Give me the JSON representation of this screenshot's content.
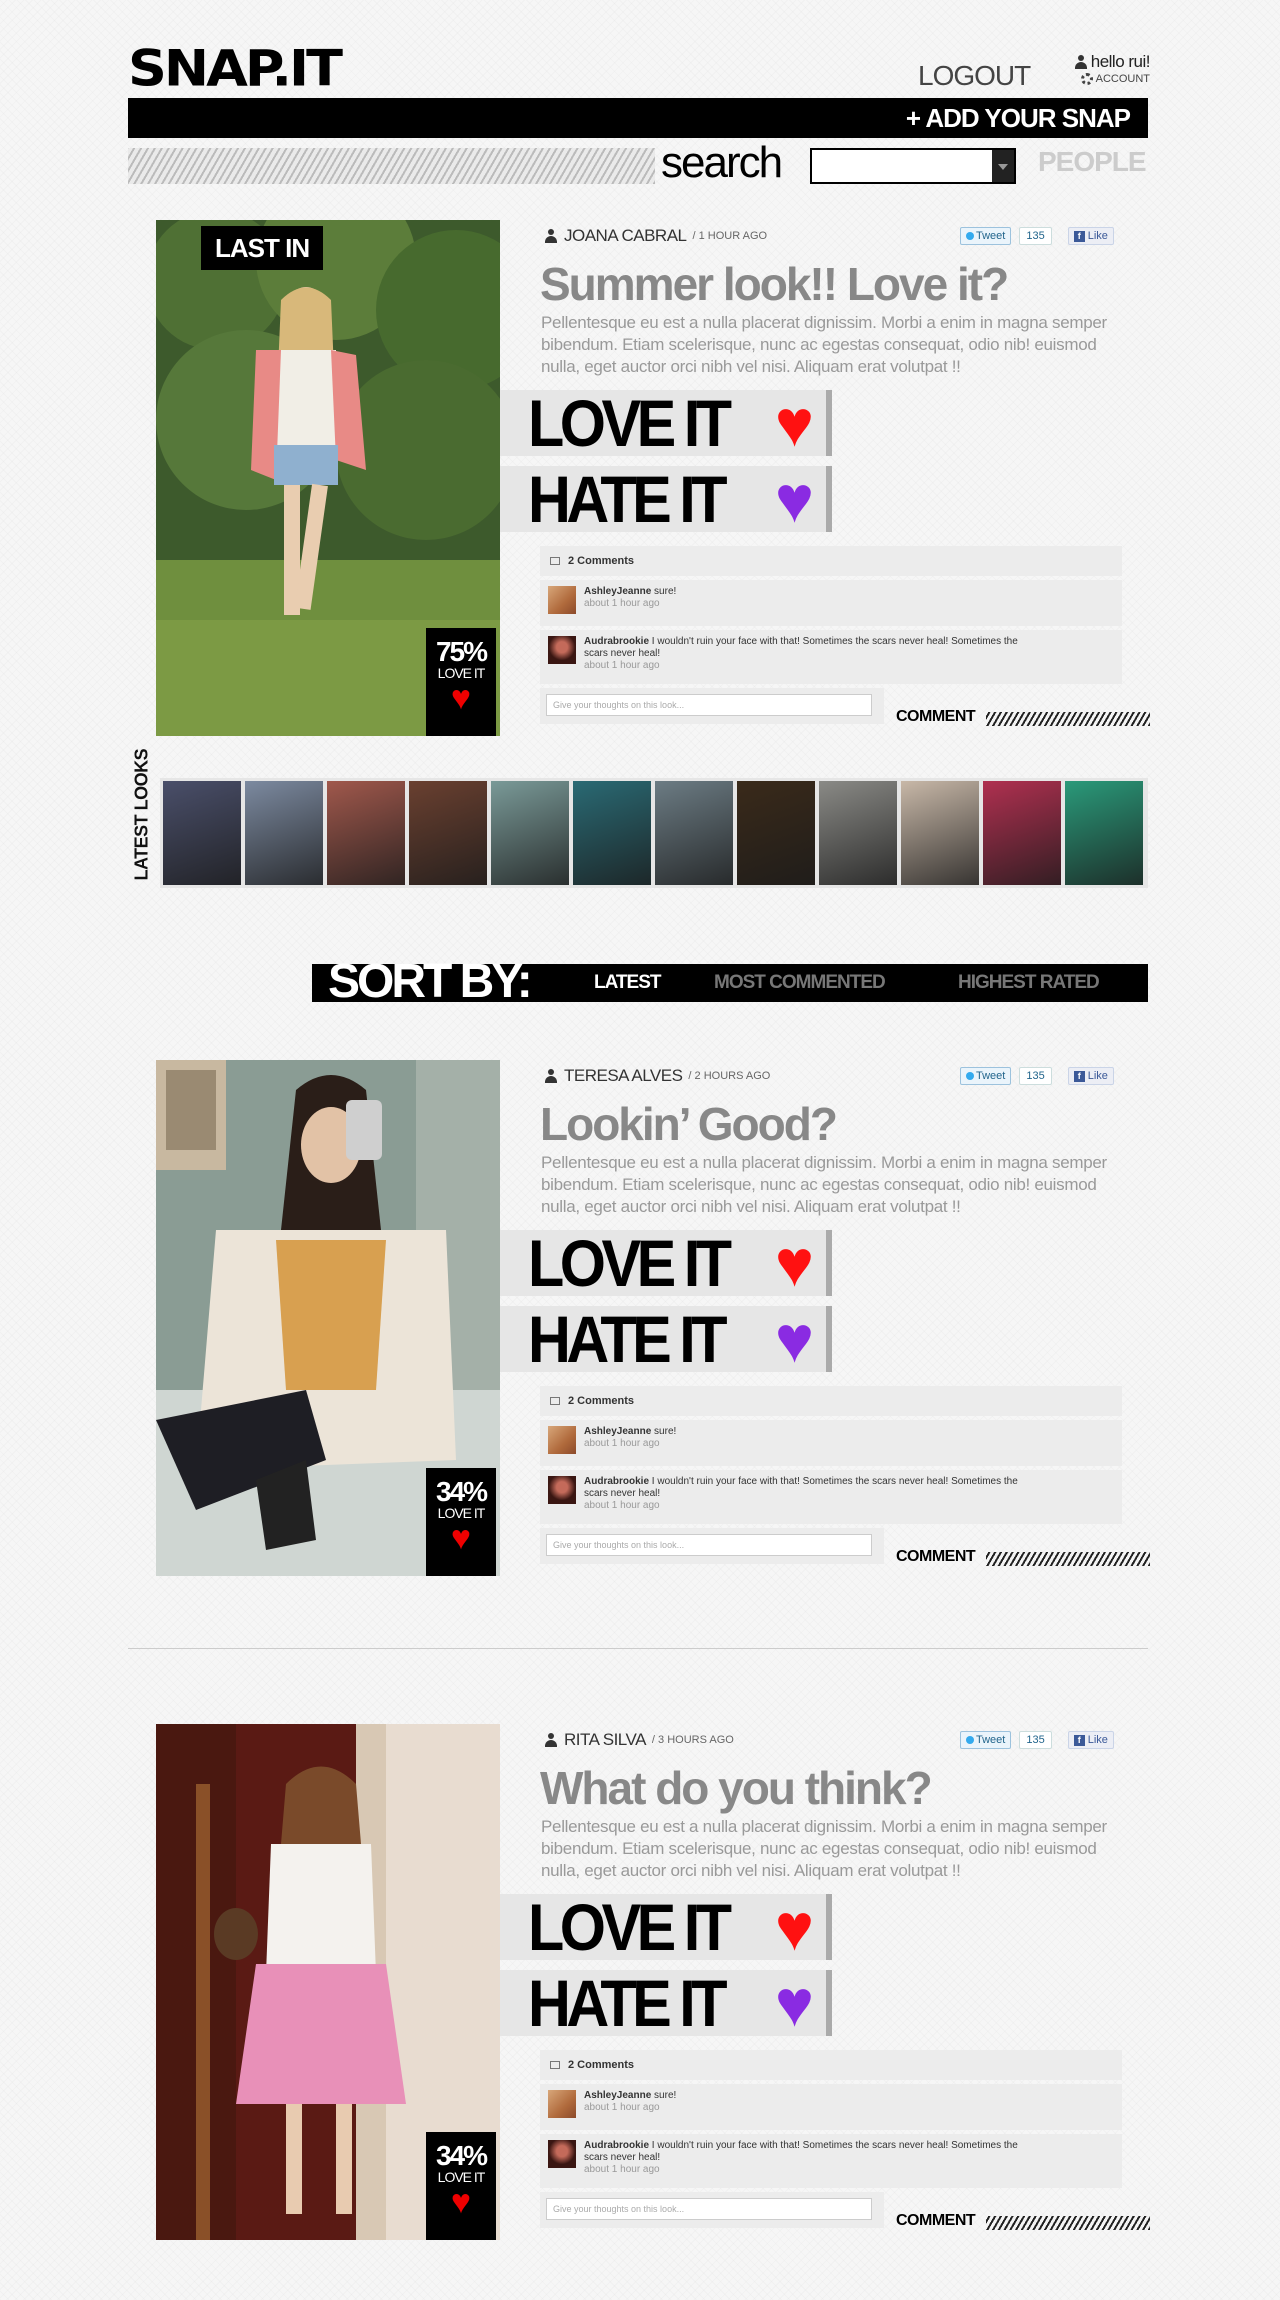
{
  "header": {
    "logo": "SNAP.IT",
    "logout": "LOGOUT",
    "greeting": "hello rui!",
    "account": "ACCOUNT",
    "add_snap": "+ ADD YOUR SNAP",
    "search_label": "search",
    "search_value": "",
    "people": "PEOPLE"
  },
  "posts": [
    {
      "badge": "LAST IN",
      "author": "JOANA CABRAL",
      "time": "/ 1 HOUR AGO",
      "tweet": "Tweet",
      "tweet_count": "135",
      "like": "Like",
      "title": "Summer look!! Love it?",
      "body": "Pellentesque eu est a nulla placerat dignissim. Morbi a enim in magna semper bibendum. Etiam scelerisque, nunc ac egestas consequat, odio nib! euismod nulla, eget auctor orci nibh vel nisi. Aliquam erat volutpat !!",
      "love_label": "LOVE IT",
      "hate_label": "HATE IT",
      "score": "75%",
      "score_label": "LOVE IT",
      "comments_header": "2 Comments",
      "comments": [
        {
          "user": "AshleyJeanne",
          "text": "sure!",
          "meta": "about 1 hour ago"
        },
        {
          "user": "Audrabrookie",
          "text": "I wouldn't ruin your face with that!  Sometimes the scars never heal! Sometimes the scars never heal!",
          "meta": "about 1 hour ago"
        }
      ],
      "comment_placeholder": "Give your thoughts on this look...",
      "comment_button": "COMMENT"
    },
    {
      "badge": "",
      "author": "TERESA ALVES",
      "time": "/ 2 HOURS AGO",
      "tweet": "Tweet",
      "tweet_count": "135",
      "like": "Like",
      "title": "Lookin’ Good?",
      "body": "Pellentesque eu est a nulla placerat dignissim. Morbi a enim in magna semper bibendum. Etiam scelerisque, nunc ac egestas consequat, odio nib! euismod nulla, eget auctor orci nibh vel nisi. Aliquam erat volutpat !!",
      "love_label": "LOVE IT",
      "hate_label": "HATE IT",
      "score": "34%",
      "score_label": "LOVE IT",
      "comments_header": "2 Comments",
      "comments": [
        {
          "user": "AshleyJeanne",
          "text": "sure!",
          "meta": "about 1 hour ago"
        },
        {
          "user": "Audrabrookie",
          "text": "I wouldn't ruin your face with that!  Sometimes the scars never heal! Sometimes the scars never heal!",
          "meta": "about 1 hour ago"
        }
      ],
      "comment_placeholder": "Give your thoughts on this look...",
      "comment_button": "COMMENT"
    },
    {
      "badge": "",
      "author": "RITA SILVA",
      "time": "/ 3 HOURS AGO",
      "tweet": "Tweet",
      "tweet_count": "135",
      "like": "Like",
      "title": "What do you think?",
      "body": "Pellentesque eu est a nulla placerat dignissim. Morbi a enim in magna semper bibendum. Etiam scelerisque, nunc ac egestas consequat, odio nib! euismod nulla, eget auctor orci nibh vel nisi. Aliquam erat volutpat !!",
      "love_label": "LOVE IT",
      "hate_label": "HATE IT",
      "score": "34%",
      "score_label": "LOVE IT",
      "comments_header": "2 Comments",
      "comments": [
        {
          "user": "AshleyJeanne",
          "text": "sure!",
          "meta": "about 1 hour ago"
        },
        {
          "user": "Audrabrookie",
          "text": "I wouldn't ruin your face with that!  Sometimes the scars never heal! Sometimes the scars never heal!",
          "meta": "about 1 hour ago"
        }
      ],
      "comment_placeholder": "Give your thoughts on this look...",
      "comment_button": "COMMENT"
    }
  ],
  "latest_looks": {
    "label": "LATEST LOOKS",
    "thumb_colors": [
      "#4a4f6a",
      "#7c8aa0",
      "#a0584c",
      "#6a4030",
      "#7a9a98",
      "#2a6a74",
      "#6c7c84",
      "#3a2a1a",
      "#8a8a86",
      "#c8b8a8",
      "#b03050",
      "#2a9a7a"
    ]
  },
  "sort": {
    "label": "SORT BY:",
    "options": [
      "LATEST",
      "MOST COMMENTED",
      "HIGHEST RATED"
    ]
  },
  "colors": {
    "love_heart": "#ff1111",
    "hate_heart": "#8a2be2",
    "title_gray": "#888888"
  },
  "icons": {
    "love": "heart-icon",
    "hate": "broken-heart-icon",
    "user": "person-icon",
    "account": "gear-icon"
  }
}
